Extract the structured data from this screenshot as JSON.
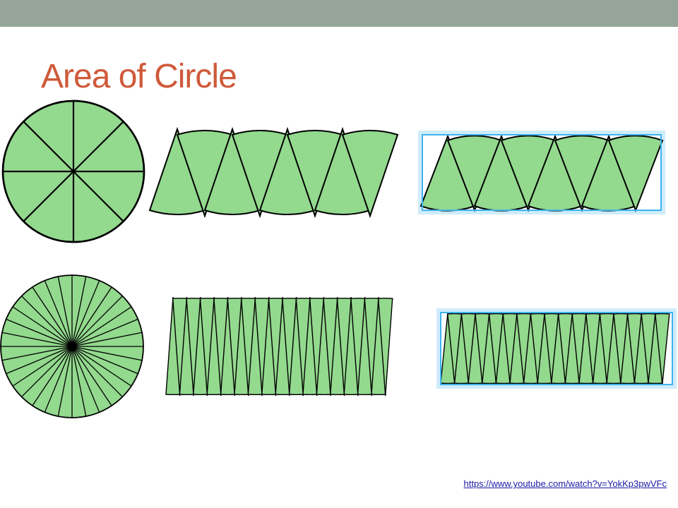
{
  "slide": {
    "title": "Area of Circle",
    "source_link": "https://www.youtube.com/watch?v=YokKp3pwVFc"
  },
  "diagram": {
    "rows": [
      {
        "name": "eight-sectors",
        "sectors": 8
      },
      {
        "name": "thirty-two-sectors",
        "sectors": 32
      }
    ]
  },
  "colors": {
    "title": "#cf5a3a",
    "top_bar": "#95a59a",
    "sector_fill": "#93d98e",
    "stroke": "#000000",
    "highlight": "#3fb4ef",
    "link": "#1a1aa6"
  }
}
